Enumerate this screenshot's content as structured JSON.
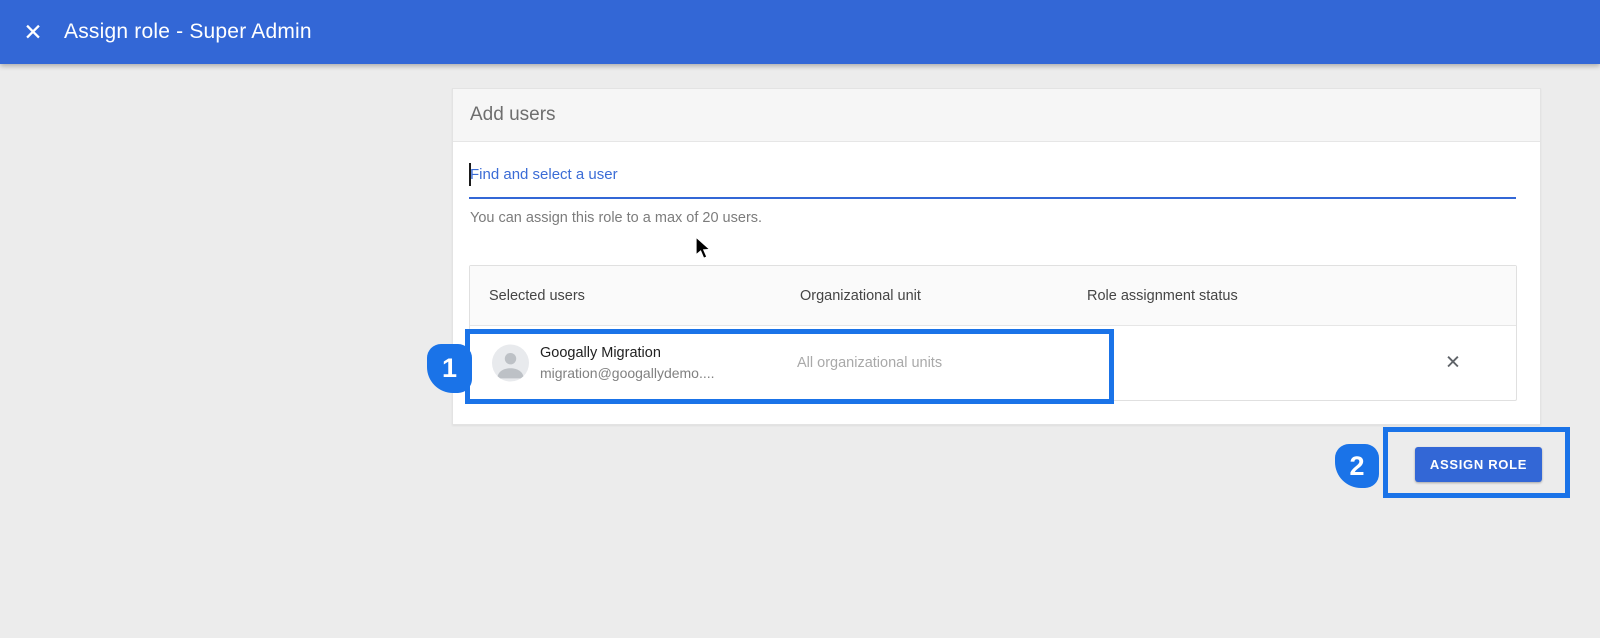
{
  "app_bar": {
    "title": "Assign role - Super Admin"
  },
  "icons": {
    "close_glyph": "✕",
    "remove_glyph": "✕"
  },
  "card": {
    "header": "Add users",
    "search": {
      "placeholder": "Find and select a user"
    },
    "helper_text": "You can assign this role to a max of 20 users.",
    "table": {
      "columns": [
        "Selected users",
        "Organizational unit",
        "Role assignment status"
      ],
      "rows": [
        {
          "name": "Googally Migration",
          "email": "migration@googallydemo....",
          "org_unit": "All organizational units",
          "status": ""
        }
      ]
    }
  },
  "actions": {
    "assign_role_label": "ASSIGN ROLE"
  },
  "annotations": {
    "step1": "1",
    "step2": "2"
  },
  "colors": {
    "app_bar_blue": "#3367d6",
    "button_blue": "#3367d6",
    "annotation_blue": "#1a73e8",
    "search_text_blue": "#3b6cd6",
    "background_gray": "#ececec"
  }
}
